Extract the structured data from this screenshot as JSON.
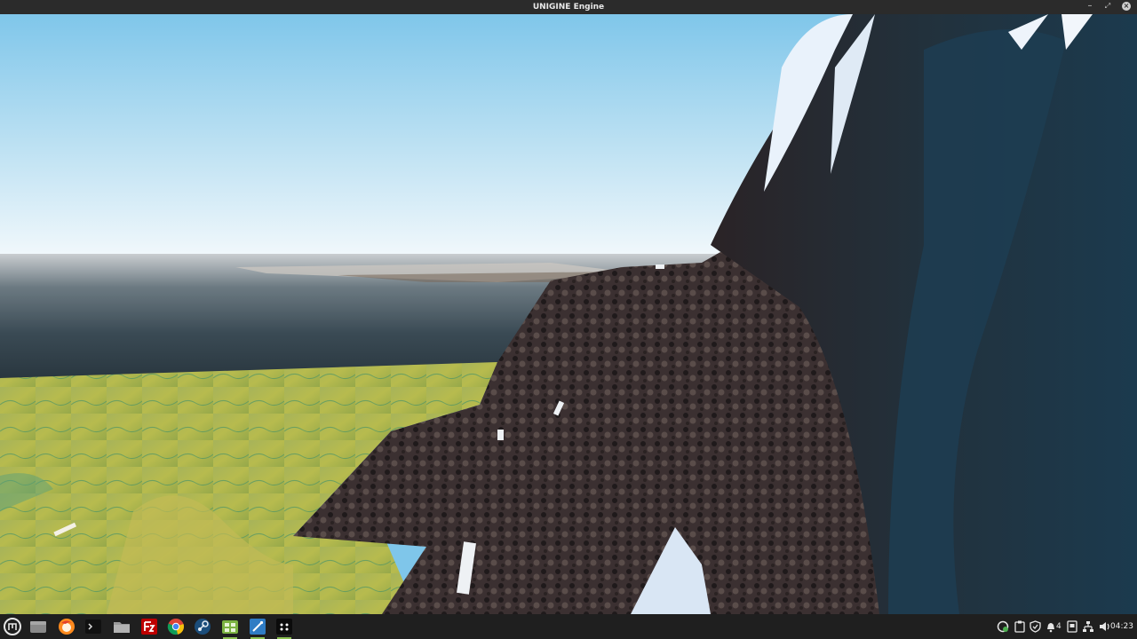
{
  "window": {
    "title": "UNIGINE Engine",
    "controls": {
      "minimize_icon": "minimize-icon",
      "maximize_icon": "maximize-icon",
      "close_icon": "close-icon"
    }
  },
  "viewport": {
    "scene": "terrain",
    "colors": {
      "sky_top": "#7fc6ea",
      "sky_horizon": "#f2f8fb",
      "sea": "#2b3a44",
      "grass": "#a9b74e",
      "rock": "#3a2f30",
      "cliff_blue": "#1f3a4c"
    }
  },
  "taskbar": {
    "launchers": [
      {
        "name": "menu",
        "icon": "mint-menu-icon"
      },
      {
        "name": "show-desktop",
        "icon": "desktop-icon"
      },
      {
        "name": "firefox",
        "icon": "firefox-icon"
      },
      {
        "name": "terminal",
        "icon": "terminal-icon"
      },
      {
        "name": "files",
        "icon": "folder-icon"
      },
      {
        "name": "filezilla",
        "icon": "filezilla-icon"
      },
      {
        "name": "chrome",
        "icon": "chrome-icon"
      },
      {
        "name": "steam",
        "icon": "steam-icon"
      },
      {
        "name": "software-manager",
        "icon": "software-manager-icon"
      },
      {
        "name": "unigine-editor",
        "icon": "unigine-editor-icon"
      },
      {
        "name": "unigine-engine",
        "icon": "unigine-app-icon"
      }
    ],
    "tray": {
      "workspace_count": "4",
      "clock": "04:23"
    }
  }
}
